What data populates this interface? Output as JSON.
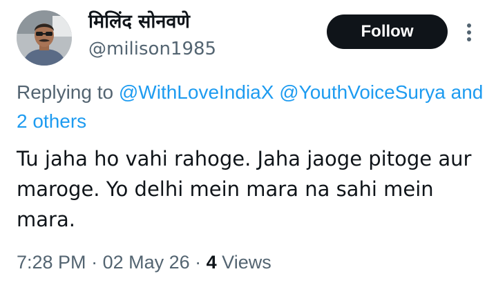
{
  "author": {
    "display_name": "मिलिंद सोनवणे",
    "handle": "@milison1985",
    "avatar_icon": "user-avatar-photo"
  },
  "actions": {
    "follow_label": "Follow",
    "more_icon": "more-vertical-icon"
  },
  "reply": {
    "prefix": "Replying to ",
    "mention_1": "@WithLoveIndiaX",
    "mention_2": "@YouthVoiceSurya",
    "and_others": "and 2 others"
  },
  "tweet": {
    "text": "Tu jaha ho vahi rahoge. Jaha jaoge pitoge aur maroge. Yo delhi mein mara na sahi mein mara."
  },
  "meta": {
    "time": "7:28 PM",
    "separator_1": " · ",
    "date": "02 May 26",
    "separator_2": " · ",
    "views_count": "4",
    "views_label": " Views"
  },
  "colors": {
    "text_primary": "#0f1419",
    "text_secondary": "#536471",
    "link": "#1d9bf0",
    "follow_bg": "#0f1419",
    "follow_text": "#ffffff"
  }
}
